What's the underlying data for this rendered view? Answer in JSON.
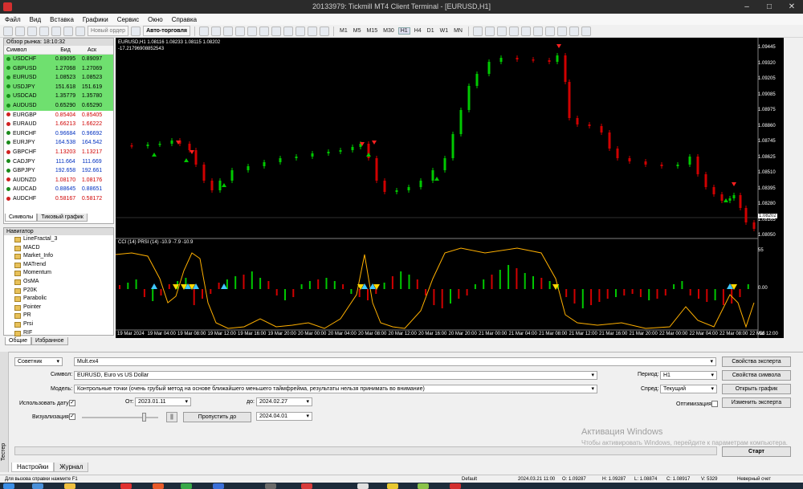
{
  "window": {
    "title": "20133979: Tickmill MT4 Client Terminal - [EURUSD,H1]"
  },
  "menu": [
    "Файл",
    "Вид",
    "Вставка",
    "Графики",
    "Сервис",
    "Окно",
    "Справка"
  ],
  "toolbar": {
    "new_order": "Новый ордер",
    "autotrading": "Авто-торговля",
    "timeframes": [
      "M1",
      "M5",
      "M15",
      "M30",
      "H1",
      "H4",
      "D1",
      "W1",
      "MN"
    ]
  },
  "market_watch": {
    "header": "Обзор рынка: 18:10:32",
    "columns": [
      "Символ",
      "Бид",
      "Аск"
    ],
    "rows": [
      {
        "symbol": "USDCHF",
        "bid": "0.89095",
        "ask": "0.89097",
        "highlight": true
      },
      {
        "symbol": "GBPUSD",
        "bid": "1.27068",
        "ask": "1.27069",
        "highlight": true
      },
      {
        "symbol": "EURUSD",
        "bid": "1.08523",
        "ask": "1.08523",
        "highlight": true
      },
      {
        "symbol": "USDJPY",
        "bid": "151.618",
        "ask": "151.619",
        "highlight": true
      },
      {
        "symbol": "USDCAD",
        "bid": "1.35779",
        "ask": "1.35780",
        "highlight": true
      },
      {
        "symbol": "AUDUSD",
        "bid": "0.65290",
        "ask": "0.65290",
        "highlight": true
      },
      {
        "symbol": "EURGBP",
        "bid": "0.85404",
        "ask": "0.85405",
        "dir": "down"
      },
      {
        "symbol": "EURAUD",
        "bid": "1.66213",
        "ask": "1.66222",
        "dir": "down"
      },
      {
        "symbol": "EURCHF",
        "bid": "0.96684",
        "ask": "0.96692",
        "dir": "up"
      },
      {
        "symbol": "EURJPY",
        "bid": "164.538",
        "ask": "164.542",
        "dir": "up"
      },
      {
        "symbol": "GBPCHF",
        "bid": "1.13203",
        "ask": "1.13217",
        "dir": "down"
      },
      {
        "symbol": "CADJPY",
        "bid": "111.664",
        "ask": "111.669",
        "dir": "up"
      },
      {
        "symbol": "GBPJPY",
        "bid": "192.658",
        "ask": "192.661",
        "dir": "up"
      },
      {
        "symbol": "AUDNZD",
        "bid": "1.08170",
        "ask": "1.08176",
        "dir": "down"
      },
      {
        "symbol": "AUDCAD",
        "bid": "0.88645",
        "ask": "0.88651",
        "dir": "up"
      },
      {
        "symbol": "AUDCHF",
        "bid": "0.58167",
        "ask": "0.58172",
        "dir": "down"
      }
    ],
    "tabs": [
      "Символы",
      "Тиковый график"
    ]
  },
  "navigator": {
    "header": "Навигатор",
    "items": [
      "LineFractal_3",
      "MACD",
      "Market_Info",
      "MATrend",
      "Momentum",
      "OsMA",
      "P20K",
      "Parabolic",
      "Pointer",
      "PR",
      "Prsi",
      "RIF"
    ],
    "tabs": [
      "Общие",
      "Избранное"
    ]
  },
  "chart": {
    "info": "EURUSD,H1  1.08116 1.08233 1.08115 1.08202",
    "info2": "-17.21796908852543",
    "sub_info": "CCI (14) PRSI (14) -10.9 -7.9 -10.9",
    "price_labels": [
      "1.09445",
      "1.09320",
      "1.09205",
      "1.09085",
      "1.08975",
      "1.08860",
      "1.08745",
      "1.08625",
      "1.08510",
      "1.08395",
      "1.08280",
      "1.08165",
      "1.08050"
    ],
    "current_price": "1.08202",
    "osc_labels": [
      "55",
      "0.00",
      "-55"
    ],
    "time_labels": [
      "19 Mar 2024",
      "19 Mar 04:00",
      "19 Mar 08:00",
      "19 Mar 12:00",
      "19 Mar 16:00",
      "19 Mar 20:00",
      "20 Mar 00:00",
      "20 Mar 04:00",
      "20 Mar 08:00",
      "20 Mar 12:00",
      "20 Mar 16:00",
      "20 Mar 20:00",
      "21 Mar 00:00",
      "21 Mar 04:00",
      "21 Mar 08:00",
      "21 Mar 12:00",
      "21 Mar 16:00",
      "21 Mar 20:00",
      "22 Mar 00:00",
      "22 Mar 04:00",
      "22 Mar 08:00",
      "22 Mar 12:00"
    ],
    "colors": {
      "bull": "#00c800",
      "bear": "#d00000",
      "signal": "#ffb000",
      "up_arrow": "#40c8ff",
      "down_arrow": "#ffd800"
    }
  },
  "tester": {
    "side_label": "Тестер",
    "type": "Советник",
    "expert": "Mult.ex4",
    "symbol_label": "Символ:",
    "symbol": "EURUSD, Euro vs US Dollar",
    "model_label": "Модель:",
    "model": "Контрольные точки (очень грубый метод на основе ближайшего меньшего таймфрейма, результаты нельзя принимать во внимание)",
    "use_date": "Использовать дату",
    "from_label": "От:",
    "from": "2023.01.11",
    "to_label": "до:",
    "to": "2024.02.27",
    "visual": "Визуализация",
    "skip_to": "Пропустить до",
    "skip_date": "2024.04.01",
    "period_label": "Период:",
    "period": "H1",
    "spread_label": "Спред:",
    "spread": "Текущий",
    "optimization": "Оптимизация",
    "buttons": [
      "Свойства эксперта",
      "Свойства символа",
      "Открыть график",
      "Изменить эксперта"
    ],
    "start": "Старт",
    "pause": "||",
    "tabs": [
      "Настройки",
      "Журнал"
    ]
  },
  "watermark": {
    "title": "Активация Windows",
    "text": "Чтобы активировать Windows, перейдите к параметрам компьютера."
  },
  "status": {
    "help": "Для вызова справки нажмите F1",
    "profile": "Default",
    "time": "2024.03.21 11:00",
    "open": "O: 1.09287",
    "high": "H: 1.09287",
    "low": "L: 1.08874",
    "close": "C: 1.08917",
    "volume": "V: 5329",
    "traffic": "Неверный счет"
  }
}
